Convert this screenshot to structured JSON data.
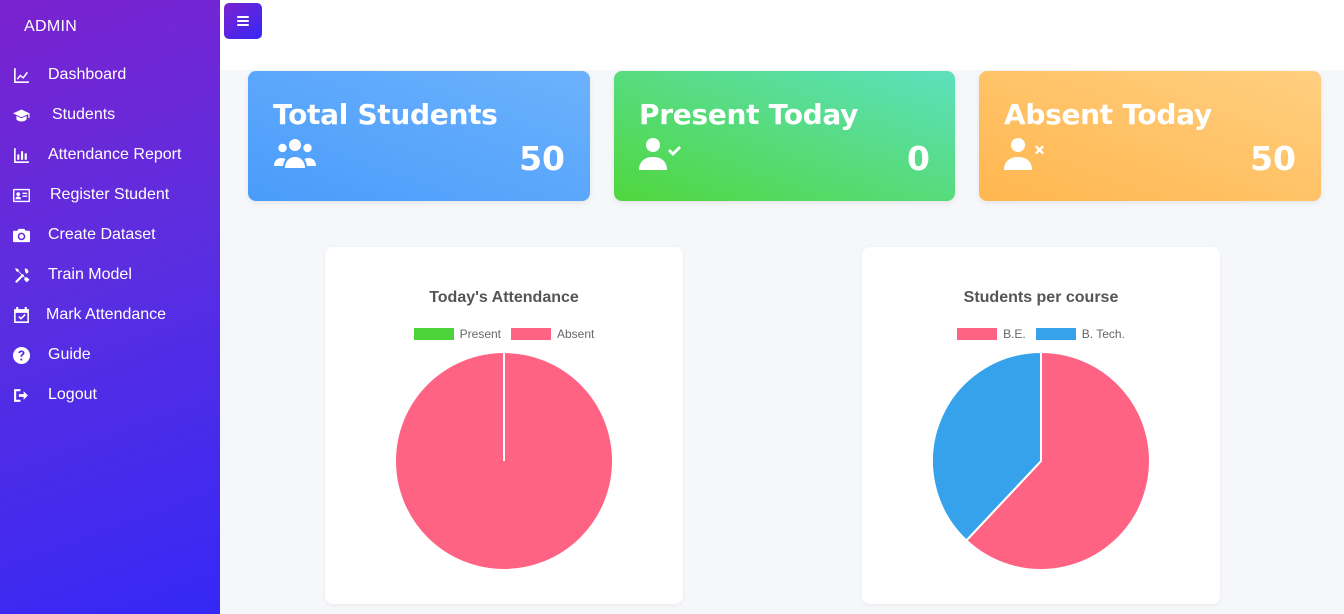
{
  "sidebar": {
    "brand": "ADMIN",
    "items": [
      {
        "label": "Dashboard",
        "icon": "chart-line-icon"
      },
      {
        "label": "Students",
        "icon": "graduation-cap-icon"
      },
      {
        "label": "Attendance Report",
        "icon": "bar-chart-icon"
      },
      {
        "label": "Register Student",
        "icon": "id-card-icon"
      },
      {
        "label": "Create Dataset",
        "icon": "camera-icon"
      },
      {
        "label": "Train Model",
        "icon": "tools-icon"
      },
      {
        "label": "Mark Attendance",
        "icon": "calendar-check-icon"
      },
      {
        "label": "Guide",
        "icon": "question-circle-icon"
      },
      {
        "label": "Logout",
        "icon": "logout-icon"
      }
    ]
  },
  "topbar": {
    "toggle_icon": "menu-icon"
  },
  "stats": {
    "total": {
      "title": "Total Students",
      "value": "50",
      "icon": "users-icon",
      "color": "#4a9cfa"
    },
    "present": {
      "title": "Present Today",
      "value": "0",
      "icon": "user-check-icon",
      "color": "#4fd73d"
    },
    "absent": {
      "title": "Absent Today",
      "value": "50",
      "icon": "user-times-icon",
      "color": "#ffb64f"
    }
  },
  "chart_data": [
    {
      "type": "pie",
      "title": "Today's Attendance",
      "categories": [
        "Present",
        "Absent"
      ],
      "values": [
        0,
        50
      ],
      "colors": [
        "#4dd33a",
        "#ff6384"
      ],
      "legend": "top"
    },
    {
      "type": "pie",
      "title": "Students per course",
      "categories": [
        "B.E.",
        "B. Tech."
      ],
      "values": [
        31,
        19
      ],
      "colors": [
        "#ff6384",
        "#36a2eb"
      ],
      "legend": "top"
    }
  ]
}
